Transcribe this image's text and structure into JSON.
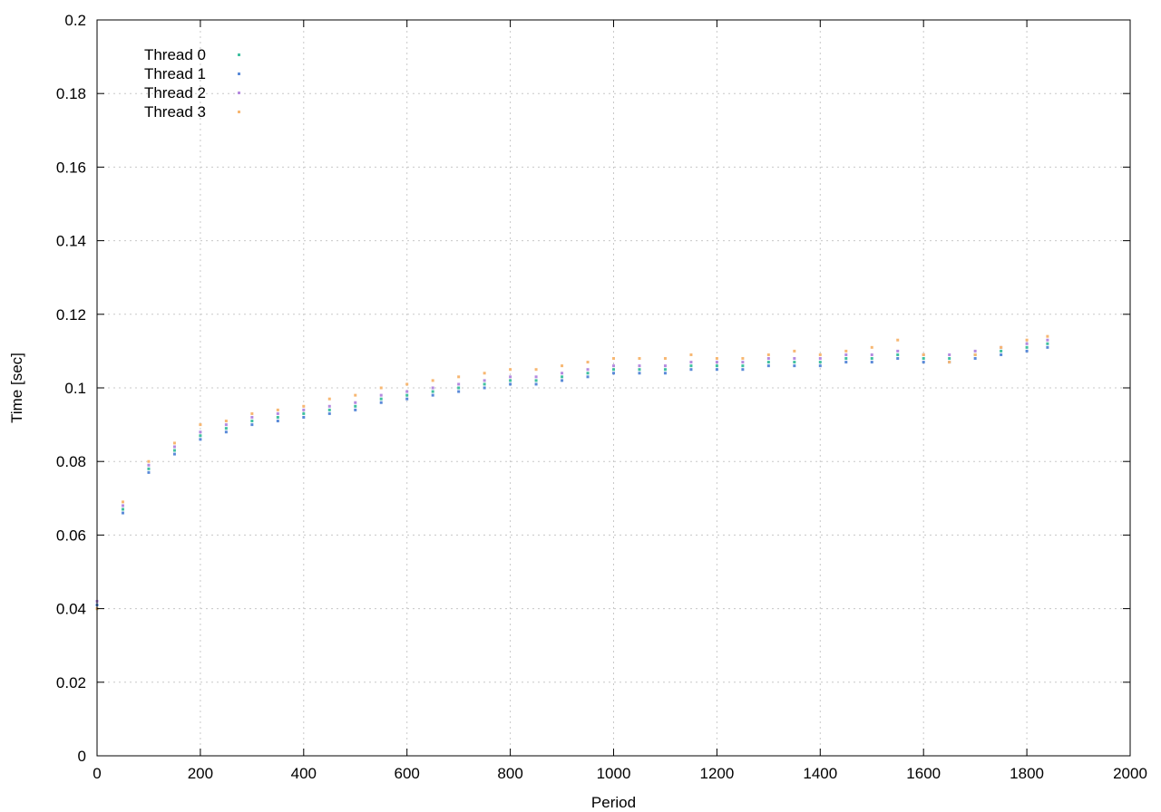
{
  "chart_data": {
    "type": "scatter",
    "title": "",
    "xlabel": "Period",
    "ylabel": "Time [sec]",
    "xlim": [
      0,
      2000
    ],
    "ylim": [
      0,
      0.2
    ],
    "x_ticks": [
      0,
      200,
      400,
      600,
      800,
      1000,
      1200,
      1400,
      1600,
      1800,
      2000
    ],
    "y_ticks": [
      0,
      0.02,
      0.04,
      0.06,
      0.08,
      0.1,
      0.12,
      0.14,
      0.16,
      0.18,
      0.2
    ],
    "x_tick_labels": [
      "0",
      "200",
      "400",
      "600",
      "800",
      "1000",
      "1200",
      "1400",
      "1600",
      "1800",
      "2000"
    ],
    "y_tick_labels": [
      "0",
      "0.02",
      "0.04",
      "0.06",
      "0.08",
      "0.1",
      "0.12",
      "0.14",
      "0.16",
      "0.18",
      "0.2"
    ],
    "grid": true,
    "legend_position": "top-left",
    "series": [
      {
        "name": "Thread 0",
        "color": "#40c0a0",
        "x": [
          0,
          50,
          100,
          150,
          200,
          250,
          300,
          350,
          400,
          450,
          500,
          550,
          600,
          650,
          700,
          750,
          800,
          850,
          900,
          950,
          1000,
          1050,
          1100,
          1150,
          1200,
          1250,
          1300,
          1350,
          1400,
          1450,
          1500,
          1550,
          1600,
          1650,
          1700,
          1750,
          1800,
          1840
        ],
        "y": [
          0.04,
          0.067,
          0.078,
          0.083,
          0.087,
          0.089,
          0.091,
          0.092,
          0.093,
          0.094,
          0.095,
          0.097,
          0.098,
          0.099,
          0.1,
          0.101,
          0.102,
          0.102,
          0.103,
          0.104,
          0.105,
          0.105,
          0.105,
          0.106,
          0.106,
          0.106,
          0.107,
          0.107,
          0.107,
          0.108,
          0.108,
          0.109,
          0.108,
          0.108,
          0.109,
          0.11,
          0.111,
          0.112
        ]
      },
      {
        "name": "Thread 1",
        "color": "#5a8ad8",
        "x": [
          0,
          50,
          100,
          150,
          200,
          250,
          300,
          350,
          400,
          450,
          500,
          550,
          600,
          650,
          700,
          750,
          800,
          850,
          900,
          950,
          1000,
          1050,
          1100,
          1150,
          1200,
          1250,
          1300,
          1350,
          1400,
          1450,
          1500,
          1550,
          1600,
          1650,
          1700,
          1750,
          1800,
          1840
        ],
        "y": [
          0.041,
          0.066,
          0.077,
          0.082,
          0.086,
          0.088,
          0.09,
          0.091,
          0.092,
          0.093,
          0.094,
          0.096,
          0.097,
          0.098,
          0.099,
          0.1,
          0.101,
          0.101,
          0.102,
          0.103,
          0.104,
          0.104,
          0.104,
          0.105,
          0.105,
          0.105,
          0.106,
          0.106,
          0.106,
          0.107,
          0.107,
          0.108,
          0.107,
          0.107,
          0.108,
          0.109,
          0.11,
          0.111
        ]
      },
      {
        "name": "Thread 2",
        "color": "#b58adf",
        "x": [
          0,
          50,
          100,
          150,
          200,
          250,
          300,
          350,
          400,
          450,
          500,
          550,
          600,
          650,
          700,
          750,
          800,
          850,
          900,
          950,
          1000,
          1050,
          1100,
          1150,
          1200,
          1250,
          1300,
          1350,
          1400,
          1450,
          1500,
          1550,
          1600,
          1650,
          1700,
          1750,
          1800,
          1840
        ],
        "y": [
          0.042,
          0.068,
          0.079,
          0.084,
          0.088,
          0.09,
          0.092,
          0.093,
          0.094,
          0.095,
          0.096,
          0.098,
          0.099,
          0.1,
          0.101,
          0.102,
          0.103,
          0.103,
          0.104,
          0.105,
          0.106,
          0.106,
          0.106,
          0.107,
          0.107,
          0.107,
          0.108,
          0.108,
          0.108,
          0.109,
          0.109,
          0.11,
          0.109,
          0.109,
          0.11,
          0.111,
          0.112,
          0.113
        ]
      },
      {
        "name": "Thread 3",
        "color": "#f7b772",
        "x": [
          0,
          50,
          100,
          150,
          200,
          250,
          300,
          350,
          400,
          450,
          500,
          550,
          600,
          650,
          700,
          750,
          800,
          850,
          900,
          950,
          1000,
          1050,
          1100,
          1150,
          1200,
          1250,
          1300,
          1350,
          1400,
          1450,
          1500,
          1550,
          1600,
          1650,
          1700,
          1750,
          1800,
          1840
        ],
        "y": [
          0.04,
          0.069,
          0.08,
          0.085,
          0.09,
          0.091,
          0.093,
          0.094,
          0.095,
          0.097,
          0.098,
          0.1,
          0.101,
          0.102,
          0.103,
          0.104,
          0.105,
          0.105,
          0.106,
          0.107,
          0.108,
          0.108,
          0.108,
          0.109,
          0.108,
          0.108,
          0.109,
          0.11,
          0.109,
          0.11,
          0.111,
          0.113,
          0.109,
          0.107,
          0.109,
          0.111,
          0.113,
          0.114
        ]
      }
    ]
  }
}
